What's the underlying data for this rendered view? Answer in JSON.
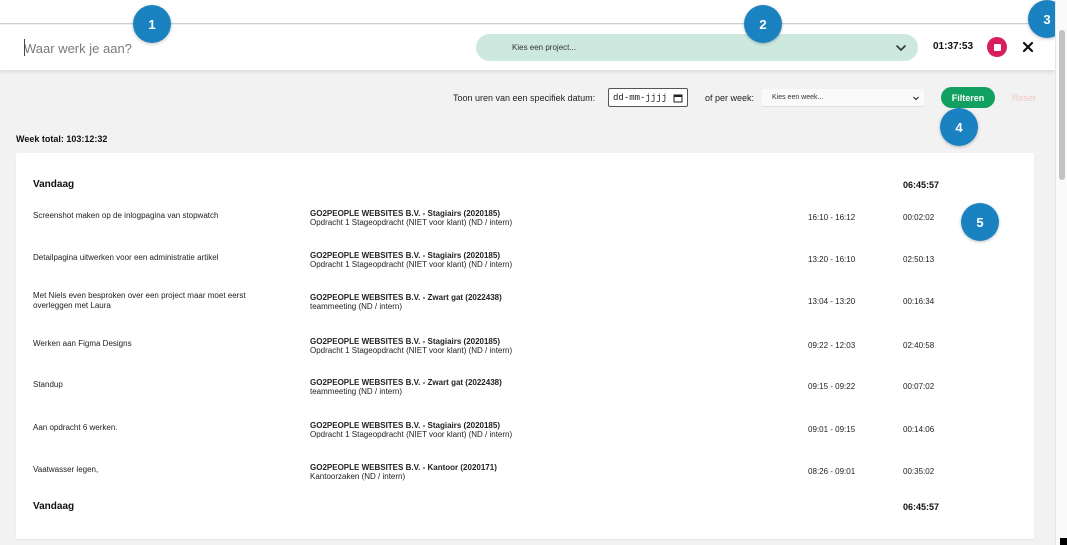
{
  "timer": {
    "task_placeholder": "Waar werk je aan?",
    "project_placeholder": "Kies een project...",
    "elapsed": "01:37:53",
    "stop_icon": "stop-icon",
    "close_icon": "close-icon"
  },
  "filters": {
    "date_label": "Toon uren van een specifiek datum:",
    "date_placeholder": "dd-mm-jjjj",
    "week_label": "of per week:",
    "week_placeholder": "Kies een week...",
    "filter_button": "Filteren",
    "reset_button": "Reset"
  },
  "week_total": "Week total: 103:12:32",
  "day": {
    "label": "Vandaag",
    "total": "06:45:57",
    "footer_label": "Vandaag",
    "footer_total": "06:45:57"
  },
  "entries": [
    {
      "description": "Screenshot maken op de inlogpagina van stopwatch",
      "project": "GO2PEOPLE WEBSITES B.V. - Stagiairs (2020185)",
      "subproject": "Opdracht 1 Stageopdracht (NIET voor klant) (ND / intern)",
      "range": "16:10 - 16:12",
      "duration": "00:02:02"
    },
    {
      "description": "Detailpagina uitwerken voor een administratie artikel",
      "project": "GO2PEOPLE WEBSITES B.V. - Stagiairs (2020185)",
      "subproject": "Opdracht 1 Stageopdracht (NIET voor klant) (ND / intern)",
      "range": "13:20 - 16:10",
      "duration": "02:50:13"
    },
    {
      "description": "Met Niels even besproken over een project maar moet eerst overleggen met Laura",
      "project": "GO2PEOPLE WEBSITES B.V. - Zwart gat (2022438)",
      "subproject": "teammeeting (ND / intern)",
      "range": "13:04 - 13:20",
      "duration": "00:16:34"
    },
    {
      "description": "Werken aan Figma Designs",
      "project": "GO2PEOPLE WEBSITES B.V. - Stagiairs (2020185)",
      "subproject": "Opdracht 1 Stageopdracht (NIET voor klant) (ND / intern)",
      "range": "09:22 - 12:03",
      "duration": "02:40:58"
    },
    {
      "description": "Standup",
      "project": "GO2PEOPLE WEBSITES B.V. - Zwart gat (2022438)",
      "subproject": "teammeeting (ND / intern)",
      "range": "09:15 - 09:22",
      "duration": "00:07:02"
    },
    {
      "description": "Aan opdracht 6 werken.",
      "project": "GO2PEOPLE WEBSITES B.V. - Stagiairs (2020185)",
      "subproject": "Opdracht 1 Stageopdracht (NIET voor klant) (ND / intern)",
      "range": "09:01 - 09:15",
      "duration": "00:14:06"
    },
    {
      "description": "Vaatwasser legen,",
      "project": "GO2PEOPLE WEBSITES B.V. - Kantoor (2020171)",
      "subproject": "Kantoorzaken (ND / intern)",
      "range": "08:26 - 09:01",
      "duration": "00:35:02"
    }
  ],
  "badges": [
    "1",
    "2",
    "3",
    "4",
    "5"
  ],
  "colors": {
    "accent_green": "#11a05f",
    "project_select_bg": "#cde9df",
    "stop_red": "#d81e5b",
    "badge_blue": "#1b82c1"
  }
}
